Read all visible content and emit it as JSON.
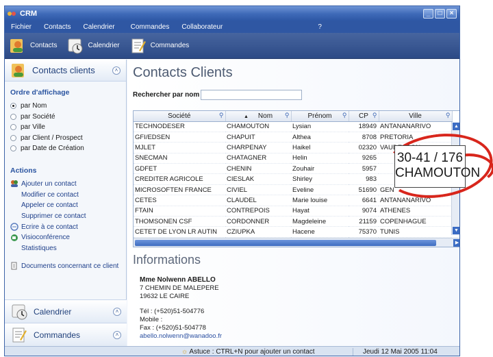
{
  "window": {
    "title": "CRM"
  },
  "menu": [
    "Fichier",
    "Contacts",
    "Calendrier",
    "Commandes",
    "Collaborateur",
    "?"
  ],
  "toolbar": [
    "Contacts",
    "Calendrier",
    "Commandes"
  ],
  "sidebar": {
    "panel_title": "Contacts clients",
    "sort_heading": "Ordre d'affichage",
    "sort_options": [
      "par Nom",
      "par Société",
      "par Ville",
      "par Client / Prospect",
      "par Date de Création"
    ],
    "selected_sort": "par Nom",
    "actions_heading": "Actions",
    "actions": [
      "Ajouter un contact",
      "Modifier ce contact",
      "Appeler ce contact",
      "Supprimer ce contact",
      "Ecrire à ce contact",
      "Visioconférence",
      "Statistiques"
    ],
    "documents": "Documents concernant ce client",
    "footer_calendar": "Calendrier",
    "footer_orders": "Commandes"
  },
  "main": {
    "title": "Contacts Clients",
    "search_label": "Rechercher par nom :",
    "search_value": "",
    "columns": [
      "Société",
      "Nom",
      "Prénom",
      "CP",
      "Ville"
    ],
    "rows": [
      [
        "TECHNODESER",
        "CHAMOUTON",
        "Lysian",
        "18949",
        "ANTANANARIVO"
      ],
      [
        "GFI/EDSEN",
        "CHAPUIT",
        "Althea",
        "8708",
        "PRETORIA"
      ],
      [
        "MJLET",
        "CHARPENAY",
        "Haikel",
        "02320",
        "VAUDESSON"
      ],
      [
        "SNECMAN",
        "CHATAGNER",
        "Helin",
        "9265",
        ""
      ],
      [
        "GDFET",
        "CHENIN",
        "Zouhair",
        "5957",
        ""
      ],
      [
        "CREDITER AGRICOLE",
        "CIESLAK",
        "Shirley",
        "983",
        ""
      ],
      [
        "MICROSOFTEN FRANCE",
        "CIVIEL",
        "Eveline",
        "51690",
        "GEN"
      ],
      [
        "CETES",
        "CLAUDEL",
        "Marie louise",
        "6641",
        "ANTANANARIVO"
      ],
      [
        "FTAIN",
        "CONTREPOIS",
        "Hayat",
        "9074",
        "ATHENES"
      ],
      [
        "THOMSONEN CSF",
        "CORDONNER",
        "Magdeleine",
        "21159",
        "COPENHAGUE"
      ],
      [
        "CETET DE LYON LR AUTIN",
        "CZIUPKA",
        "Hacene",
        "75370",
        "TUNIS"
      ]
    ],
    "info_title": "Informations",
    "contact": {
      "name": "Mme Nolwenn ABELLO",
      "address1": "7 CHEMIN DE MALEPERE",
      "address2": "19632 LE CAIRE",
      "tel": "Tél : (+520)51-504776",
      "mobile": "Mobile :",
      "fax": "Fax : (+520)51-504778",
      "email": "abello.nolwenn@wanadoo.fr"
    }
  },
  "tooltip": {
    "range": "30-41 / 176",
    "name": "CHAMOUTON"
  },
  "status": {
    "tip": "Astuce : CTRL+N pour ajouter un contact",
    "date": "Jeudi 12 Mai 2005 11:04"
  }
}
